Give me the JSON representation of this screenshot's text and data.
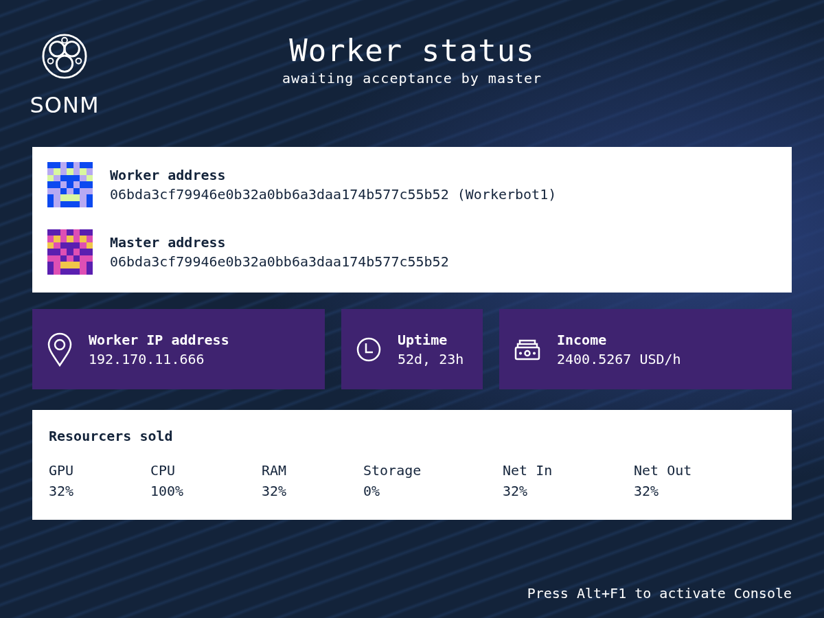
{
  "logo": {
    "name": "SONM"
  },
  "header": {
    "title": "Worker status",
    "subtitle": "awaiting acceptance by master"
  },
  "addresses": [
    {
      "label": "Worker address",
      "value": "06bda3cf79946e0b32a0bb6a3daa174b577c55b52 (Workerbot1)"
    },
    {
      "label": "Master address",
      "value": "06bda3cf79946e0b32a0bb6a3daa174b577c55b52"
    }
  ],
  "stats": [
    {
      "kind": "location",
      "label": "Worker IP address",
      "value": "192.170.11.666"
    },
    {
      "kind": "clock",
      "label": "Uptime",
      "value": "52d, 23h"
    },
    {
      "kind": "money",
      "label": "Income",
      "value": "2400.5267 USD/h"
    }
  ],
  "resources": {
    "title": "Resourcers sold",
    "columns": [
      {
        "label": "GPU",
        "value": "32%"
      },
      {
        "label": "CPU",
        "value": "100%"
      },
      {
        "label": "RAM",
        "value": "32%"
      },
      {
        "label": "Storage",
        "value": "0%"
      },
      {
        "label": "Net In",
        "value": "32%"
      },
      {
        "label": "Net Out",
        "value": "32%"
      }
    ]
  },
  "footer": {
    "hint": "Press Alt+F1 to activate Console"
  }
}
